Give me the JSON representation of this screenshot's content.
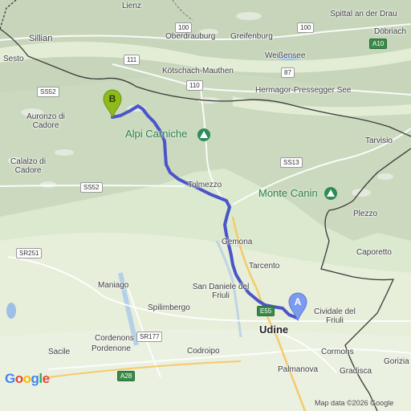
{
  "places": {
    "lienz": "Lienz",
    "spittal": "Spittal an der Drau",
    "dobriach": "Döbriach",
    "sillian": "Sillian",
    "oberdrauburg": "Oberdrauburg",
    "greifenburg": "Greifenburg",
    "sesto": "Sesto",
    "weissensee": "Weißensee",
    "koetschach": "Kötschach-Mauthen",
    "hermagor": "Hermagor-Pressegger See",
    "auronzo": "Auronzo di Cadore",
    "udine_top": "Udine",
    "tarvisio": "Tarvisio",
    "calalzo": "Calalzo di Cadore",
    "tolmezzo": "Tolmezzo",
    "plezzo": "Plezzo",
    "gemona": "Gemona",
    "caporetto": "Caporetto",
    "tarcento": "Tarcento",
    "maniago": "Maniago",
    "san_daniele": "San Daniele del Friuli",
    "cividale": "Cividale del Friuli",
    "spilimbergo": "Spilimbergo",
    "udine": "Udine",
    "cordenons_pordenone": "Cordenons Pordenone",
    "cordenons": "Cordenons",
    "pordenone": "Pordenone",
    "cormons": "Cormons",
    "sacile": "Sacile",
    "codroipo": "Codroipo",
    "gorizia": "Gorizia",
    "palmanova": "Palmanova",
    "gradisca": "Gradisca"
  },
  "parks": {
    "alpi_carniche": "Alpi Carniche",
    "monte_canin": "Monte Canin"
  },
  "roads": {
    "r100a": "100",
    "r100b": "100",
    "a10": "A10",
    "r111": "111",
    "r87": "87",
    "r110": "110",
    "ss52a": "SS52",
    "ss13": "SS13",
    "ss52b": "SS52",
    "sr251": "SR251",
    "e55": "E55",
    "sr177": "SR177",
    "a28": "A28"
  },
  "markers": {
    "start": "A",
    "end": "B"
  },
  "attribution": {
    "google": "Google",
    "map_data": "Map data ©2026 Google"
  },
  "colors": {
    "route": "#4a55c8",
    "marker_a": "#7c9bf0",
    "marker_b": "#8dbb1b",
    "border": "#3a3a3a",
    "mountain": "#d3ddc9",
    "valley": "#e6efd8",
    "water": "#9cc0e6"
  }
}
